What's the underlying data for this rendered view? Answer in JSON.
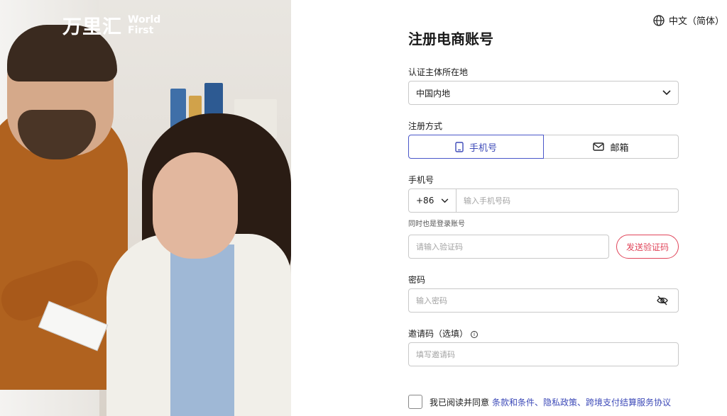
{
  "brand": {
    "logo_cn": "万里汇",
    "logo_en_line1": "World",
    "logo_en_line2": "First"
  },
  "language": {
    "label": "中文（简体）",
    "icon": "globe-icon"
  },
  "form": {
    "title": "注册电商账号",
    "region": {
      "label": "认证主体所在地",
      "value": "中国内地"
    },
    "method": {
      "label": "注册方式",
      "options": [
        "手机号",
        "邮箱"
      ],
      "selected": "手机号"
    },
    "phone": {
      "label": "手机号",
      "country_code": "+86",
      "placeholder": "输入手机号码",
      "hint": "同时也是登录账号"
    },
    "verification": {
      "placeholder": "请输入验证码",
      "send_label": "发送验证码"
    },
    "password": {
      "label": "密码",
      "placeholder": "输入密码"
    },
    "invite": {
      "label": "邀请码（选填）",
      "placeholder": "填写邀请码"
    },
    "agreement": {
      "text": "我已阅读并同意",
      "links": "条款和条件、隐私政策、跨境支付结算服务协议"
    }
  },
  "colors": {
    "accent": "#3d4ab8",
    "danger": "#e0455a",
    "border": "#c9c9c9"
  }
}
